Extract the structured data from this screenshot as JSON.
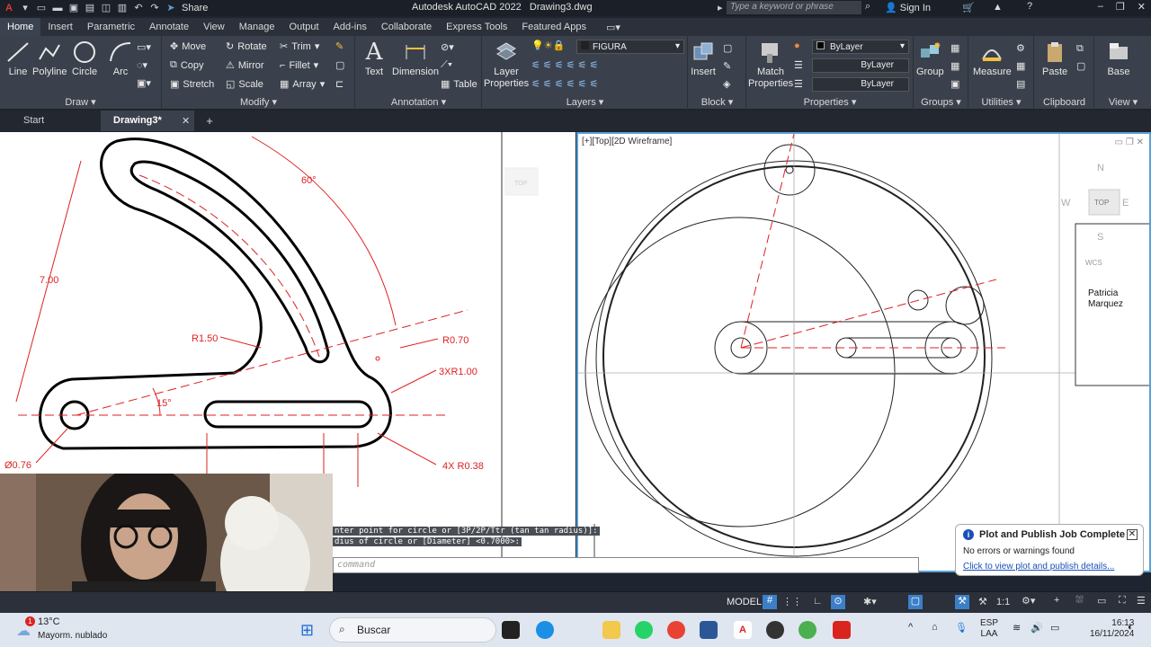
{
  "titlebar": {
    "app_title": "Autodesk AutoCAD 2022",
    "file_name": "Drawing3.dwg",
    "share_label": "Share",
    "search_placeholder": "Type a keyword or phrase",
    "signin_label": "Sign In"
  },
  "ribbon_tabs": [
    "Home",
    "Insert",
    "Parametric",
    "Annotate",
    "View",
    "Manage",
    "Output",
    "Add-ins",
    "Collaborate",
    "Express Tools",
    "Featured Apps"
  ],
  "ribbon": {
    "draw": {
      "title": "Draw",
      "line": "Line",
      "polyline": "Polyline",
      "circle": "Circle",
      "arc": "Arc"
    },
    "modify": {
      "title": "Modify",
      "move": "Move",
      "rotate": "Rotate",
      "trim": "Trim",
      "copy": "Copy",
      "mirror": "Mirror",
      "fillet": "Fillet",
      "stretch": "Stretch",
      "scale": "Scale",
      "array": "Array"
    },
    "annotation": {
      "title": "Annotation",
      "text": "Text",
      "dimension": "Dimension",
      "table": "Table"
    },
    "layers": {
      "title": "Layers",
      "layer_properties": "Layer Properties",
      "current_layer": "FIGURA"
    },
    "block": {
      "title": "Block",
      "insert": "Insert"
    },
    "properties": {
      "title": "Properties",
      "match": "Match Properties",
      "color": "ByLayer",
      "linetype": "ByLayer",
      "lineweight": "ByLayer"
    },
    "groups": {
      "title": "Groups",
      "group": "Group"
    },
    "utilities": {
      "title": "Utilities",
      "measure": "Measure"
    },
    "clipboard": {
      "title": "Clipboard",
      "paste": "Paste"
    },
    "view": {
      "title": "View",
      "base": "Base"
    }
  },
  "file_tabs": {
    "start": "Start",
    "active": "Drawing3*"
  },
  "left_viewport": {
    "dims": {
      "angle60": "60°",
      "len700": "7.00",
      "r150": "R1.50",
      "r070": "R0.70",
      "r3x": "3XR1.00",
      "a15": "15°",
      "d076": "Ø0.76",
      "r4x": "4X R0.38"
    },
    "viewcube_top": "TOP"
  },
  "right_viewport": {
    "label": "[+][Top][2D Wireframe]",
    "viewcube": {
      "n": "N",
      "w": "W",
      "e": "E",
      "s": "S",
      "top": "TOP",
      "wcs": "WCS"
    },
    "name_text_1": "Patricia",
    "name_text_2": "Marquez"
  },
  "command": {
    "line1": "nter point for circle or [3P/2P/Ttr (tan tan radius)]:",
    "line2": "dius of circle or [Diameter] <0.7000>:",
    "input_placeholder": "command"
  },
  "statusbar": {
    "model": "MODEL",
    "scale": "1:1"
  },
  "notification": {
    "title": "Plot and Publish Job Complete",
    "message": "No errors or warnings found",
    "link": "Click to view plot and publish details..."
  },
  "taskbar": {
    "weather_temp": "13°C",
    "weather_desc": "Mayorm. nublado",
    "weather_badge": "1",
    "search_label": "Buscar",
    "lang1": "ESP",
    "lang2": "LAA",
    "time": "16:13",
    "date": "16/11/2024"
  }
}
